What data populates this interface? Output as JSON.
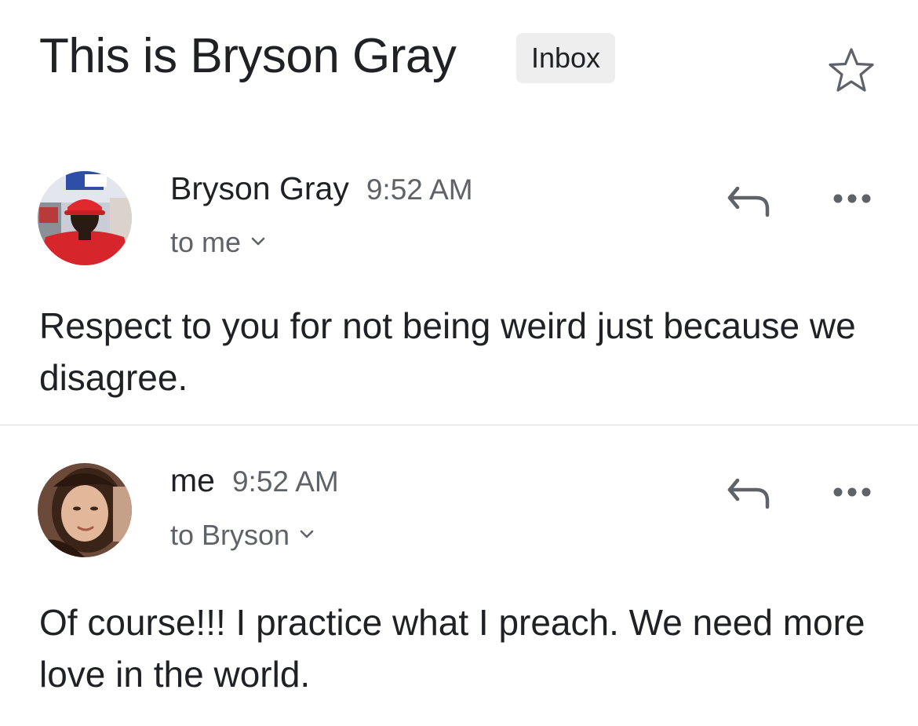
{
  "thread": {
    "subject": "This is Bryson Gray",
    "label": "Inbox"
  },
  "messages": [
    {
      "sender": "Bryson Gray",
      "time": "9:52 AM",
      "recipients": "to me",
      "body": "Respect to you for not being weird just because we disagree."
    },
    {
      "sender": "me",
      "time": "9:52 AM",
      "recipients": "to Bryson",
      "body": "Of course!!! I practice what I preach. We need more love in the world."
    }
  ],
  "colors": {
    "primary_text": "#202124",
    "secondary_text": "#5f6368",
    "chip_background": "#eeeeee",
    "divider": "#dadce0",
    "icon": "#5f6368"
  },
  "icons": {
    "star": "star-outline-icon",
    "reply": "reply-arrow-icon",
    "more": "more-horizontal-icon",
    "expand": "chevron-down-icon"
  }
}
